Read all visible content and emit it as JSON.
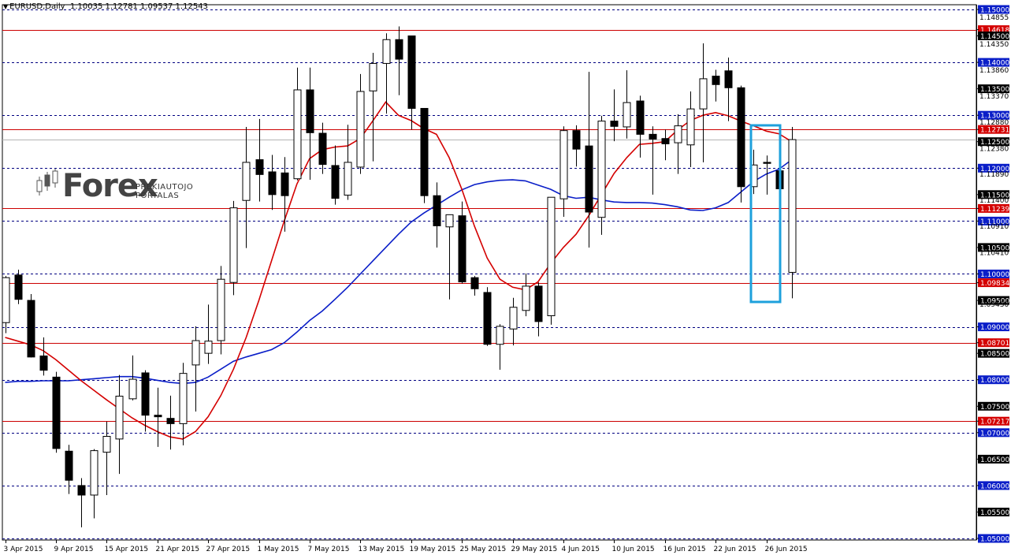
{
  "header": {
    "symbol": "EURUSD,Daily",
    "ohlc": "1.10035 1.12781 1.09537 1.12543"
  },
  "logo": {
    "main": "Forex",
    "line1": "PREKIAUTOJO",
    "line2": "PORTALAS"
  },
  "colors": {
    "bull_body": "#ffffff",
    "bear_body": "#000000",
    "dashed_level": "#000080",
    "red_level": "#cc0000",
    "ma_fast": "#d40000",
    "ma_slow": "#0a1ec8",
    "highlight": "#1ea0dc",
    "label_red": "#d40000",
    "label_blue": "#0a1ec8",
    "label_black": "#000000"
  },
  "chart_data": {
    "type": "candlestick",
    "symbol": "EURUSD",
    "timeframe": "Daily",
    "ylim": [
      1.05,
      1.15
    ],
    "x_tick_labels": [
      "3 Apr 2015",
      "9 Apr 2015",
      "15 Apr 2015",
      "21 Apr 2015",
      "27 Apr 2015",
      "1 May 2015",
      "7 May 2015",
      "13 May 2015",
      "19 May 2015",
      "25 May 2015",
      "29 May 2015",
      "4 Jun 2015",
      "10 Jun 2015",
      "16 Jun 2015",
      "22 Jun 2015",
      "26 Jun 2015"
    ],
    "x_tick_index": [
      0,
      4,
      8,
      12,
      16,
      20,
      24,
      28,
      32,
      36,
      40,
      44,
      48,
      52,
      56,
      60
    ],
    "price_labels": [
      {
        "text": "1.15000",
        "value": 1.15,
        "style": "blue"
      },
      {
        "text": "1.14855",
        "value": 1.14855,
        "style": "plain"
      },
      {
        "text": "1.14618",
        "value": 1.14618,
        "style": "red"
      },
      {
        "text": "1.14500",
        "value": 1.145,
        "style": "black"
      },
      {
        "text": "1.14350",
        "value": 1.1435,
        "style": "plain"
      },
      {
        "text": "1.14000",
        "value": 1.14,
        "style": "blue"
      },
      {
        "text": "1.13860",
        "value": 1.1386,
        "style": "plain"
      },
      {
        "text": "1.13500",
        "value": 1.135,
        "style": "black"
      },
      {
        "text": "1.13370",
        "value": 1.1337,
        "style": "plain"
      },
      {
        "text": "1.13000",
        "value": 1.13,
        "style": "blue"
      },
      {
        "text": "1.12880",
        "value": 1.1288,
        "style": "plain"
      },
      {
        "text": "1.12731",
        "value": 1.12731,
        "style": "red"
      },
      {
        "text": "1.12500",
        "value": 1.125,
        "style": "black"
      },
      {
        "text": "1.12380",
        "value": 1.1238,
        "style": "plain"
      },
      {
        "text": "1.12000",
        "value": 1.12,
        "style": "blue"
      },
      {
        "text": "1.11890",
        "value": 1.1189,
        "style": "plain"
      },
      {
        "text": "1.11500",
        "value": 1.115,
        "style": "black"
      },
      {
        "text": "1.11400",
        "value": 1.114,
        "style": "plain"
      },
      {
        "text": "1.11239",
        "value": 1.11239,
        "style": "red"
      },
      {
        "text": "1.11000",
        "value": 1.11,
        "style": "blue"
      },
      {
        "text": "1.10910",
        "value": 1.1091,
        "style": "plain"
      },
      {
        "text": "1.10500",
        "value": 1.105,
        "style": "black"
      },
      {
        "text": "1.10410",
        "value": 1.1041,
        "style": "plain"
      },
      {
        "text": "1.10000",
        "value": 1.1,
        "style": "blue"
      },
      {
        "text": "1.09834",
        "value": 1.09834,
        "style": "red"
      },
      {
        "text": "1.09500",
        "value": 1.095,
        "style": "black"
      },
      {
        "text": "1.09430",
        "value": 1.0943,
        "style": "plain"
      },
      {
        "text": "1.09000",
        "value": 1.09,
        "style": "blue"
      },
      {
        "text": "1.08701",
        "value": 1.08701,
        "style": "red"
      },
      {
        "text": "1.08500",
        "value": 1.085,
        "style": "black"
      },
      {
        "text": "1.08000",
        "value": 1.08,
        "style": "blue"
      },
      {
        "text": "1.07500",
        "value": 1.075,
        "style": "black"
      },
      {
        "text": "1.07217",
        "value": 1.07217,
        "style": "red"
      },
      {
        "text": "1.07000",
        "value": 1.07,
        "style": "blue"
      },
      {
        "text": "1.06500",
        "value": 1.065,
        "style": "black"
      },
      {
        "text": "1.06000",
        "value": 1.06,
        "style": "blue"
      },
      {
        "text": "1.05500",
        "value": 1.055,
        "style": "black"
      },
      {
        "text": "1.05000",
        "value": 1.05,
        "style": "blue"
      }
    ],
    "dashed_levels": [
      1.15,
      1.14,
      1.13,
      1.12,
      1.11,
      1.1,
      1.09,
      1.08,
      1.07,
      1.06,
      1.05
    ],
    "red_levels": [
      1.14618,
      1.12731,
      1.11239,
      1.09834,
      1.08701,
      1.07217
    ],
    "current_price": 1.12543,
    "candles": [
      {
        "o": 1.0908,
        "h": 1.0996,
        "l": 1.0888,
        "c": 1.0993
      },
      {
        "o": 1.0998,
        "h": 1.1008,
        "l": 1.0943,
        "c": 1.0952
      },
      {
        "o": 1.095,
        "h": 1.0962,
        "l": 1.0842,
        "c": 1.0843
      },
      {
        "o": 1.0845,
        "h": 1.088,
        "l": 1.0808,
        "c": 1.0818
      },
      {
        "o": 1.0805,
        "h": 1.0815,
        "l": 1.0662,
        "c": 1.067
      },
      {
        "o": 1.0665,
        "h": 1.0677,
        "l": 1.0584,
        "c": 1.061
      },
      {
        "o": 1.06,
        "h": 1.0614,
        "l": 1.0521,
        "c": 1.0582
      },
      {
        "o": 1.0582,
        "h": 1.0669,
        "l": 1.0538,
        "c": 1.0666
      },
      {
        "o": 1.0663,
        "h": 1.0721,
        "l": 1.0582,
        "c": 1.0693
      },
      {
        "o": 1.0688,
        "h": 1.0809,
        "l": 1.0622,
        "c": 1.0769
      },
      {
        "o": 1.0764,
        "h": 1.0846,
        "l": 1.0761,
        "c": 1.0801
      },
      {
        "o": 1.0813,
        "h": 1.0818,
        "l": 1.0702,
        "c": 1.0733
      },
      {
        "o": 1.0733,
        "h": 1.0785,
        "l": 1.0673,
        "c": 1.073
      },
      {
        "o": 1.0727,
        "h": 1.077,
        "l": 1.0668,
        "c": 1.0717
      },
      {
        "o": 1.0717,
        "h": 1.0832,
        "l": 1.0676,
        "c": 1.0812
      },
      {
        "o": 1.0828,
        "h": 1.0901,
        "l": 1.074,
        "c": 1.0874
      },
      {
        "o": 1.085,
        "h": 1.0942,
        "l": 1.083,
        "c": 1.0873
      },
      {
        "o": 1.0874,
        "h": 1.1015,
        "l": 1.0848,
        "c": 1.099
      },
      {
        "o": 1.0984,
        "h": 1.1138,
        "l": 1.096,
        "c": 1.1125
      },
      {
        "o": 1.1139,
        "h": 1.1278,
        "l": 1.1049,
        "c": 1.1211
      },
      {
        "o": 1.1216,
        "h": 1.1293,
        "l": 1.1137,
        "c": 1.1188
      },
      {
        "o": 1.1193,
        "h": 1.1225,
        "l": 1.1121,
        "c": 1.115
      },
      {
        "o": 1.1191,
        "h": 1.1221,
        "l": 1.108,
        "c": 1.1148
      },
      {
        "o": 1.118,
        "h": 1.139,
        "l": 1.1177,
        "c": 1.1348
      },
      {
        "o": 1.1348,
        "h": 1.139,
        "l": 1.1178,
        "c": 1.1267
      },
      {
        "o": 1.1266,
        "h": 1.1286,
        "l": 1.1189,
        "c": 1.1207
      },
      {
        "o": 1.1205,
        "h": 1.1243,
        "l": 1.1131,
        "c": 1.1143
      },
      {
        "o": 1.1149,
        "h": 1.1282,
        "l": 1.114,
        "c": 1.1211
      },
      {
        "o": 1.1202,
        "h": 1.1378,
        "l": 1.1189,
        "c": 1.1345
      },
      {
        "o": 1.1346,
        "h": 1.1418,
        "l": 1.1213,
        "c": 1.1398
      },
      {
        "o": 1.1398,
        "h": 1.1455,
        "l": 1.1303,
        "c": 1.1443
      },
      {
        "o": 1.1443,
        "h": 1.1468,
        "l": 1.1338,
        "c": 1.1406
      },
      {
        "o": 1.145,
        "h": 1.145,
        "l": 1.1273,
        "c": 1.1313
      },
      {
        "o": 1.1313,
        "h": 1.1313,
        "l": 1.1134,
        "c": 1.1148
      },
      {
        "o": 1.1148,
        "h": 1.1173,
        "l": 1.105,
        "c": 1.1091
      },
      {
        "o": 1.1089,
        "h": 1.1106,
        "l": 1.0952,
        "c": 1.1112
      },
      {
        "o": 1.111,
        "h": 1.1137,
        "l": 1.0982,
        "c": 1.0985
      },
      {
        "o": 1.0993,
        "h": 1.0996,
        "l": 1.0959,
        "c": 1.0972
      },
      {
        "o": 1.0965,
        "h": 1.0975,
        "l": 1.0864,
        "c": 1.0867
      },
      {
        "o": 1.0867,
        "h": 1.0905,
        "l": 1.0819,
        "c": 1.0901
      },
      {
        "o": 1.0896,
        "h": 1.0955,
        "l": 1.0865,
        "c": 1.0937
      },
      {
        "o": 1.0931,
        "h": 1.1001,
        "l": 1.092,
        "c": 1.0977
      },
      {
        "o": 1.0977,
        "h": 1.0984,
        "l": 1.0882,
        "c": 1.091
      },
      {
        "o": 1.0921,
        "h": 1.114,
        "l": 1.0904,
        "c": 1.1145
      },
      {
        "o": 1.1142,
        "h": 1.1279,
        "l": 1.1108,
        "c": 1.1271
      },
      {
        "o": 1.1271,
        "h": 1.1281,
        "l": 1.1203,
        "c": 1.1236
      },
      {
        "o": 1.1242,
        "h": 1.1382,
        "l": 1.105,
        "c": 1.1117
      },
      {
        "o": 1.1107,
        "h": 1.1299,
        "l": 1.1074,
        "c": 1.1289
      },
      {
        "o": 1.1289,
        "h": 1.1349,
        "l": 1.1251,
        "c": 1.1279
      },
      {
        "o": 1.1278,
        "h": 1.1385,
        "l": 1.1256,
        "c": 1.1324
      },
      {
        "o": 1.1327,
        "h": 1.1337,
        "l": 1.122,
        "c": 1.1264
      },
      {
        "o": 1.1264,
        "h": 1.1279,
        "l": 1.115,
        "c": 1.1255
      },
      {
        "o": 1.1256,
        "h": 1.1273,
        "l": 1.1215,
        "c": 1.1246
      },
      {
        "o": 1.1248,
        "h": 1.1302,
        "l": 1.1189,
        "c": 1.128
      },
      {
        "o": 1.1244,
        "h": 1.1345,
        "l": 1.1202,
        "c": 1.1312
      },
      {
        "o": 1.1312,
        "h": 1.1436,
        "l": 1.1211,
        "c": 1.1369
      },
      {
        "o": 1.1374,
        "h": 1.1386,
        "l": 1.1326,
        "c": 1.1358
      },
      {
        "o": 1.1384,
        "h": 1.1409,
        "l": 1.1289,
        "c": 1.1352
      },
      {
        "o": 1.1352,
        "h": 1.1356,
        "l": 1.1135,
        "c": 1.1165
      },
      {
        "o": 1.1165,
        "h": 1.1235,
        "l": 1.1151,
        "c": 1.1206
      },
      {
        "o": 1.1211,
        "h": 1.1224,
        "l": 1.115,
        "c": 1.1209
      },
      {
        "o": 1.1195,
        "h": 1.1208,
        "l": 1.112,
        "c": 1.1161
      },
      {
        "o": 1.1003,
        "h": 1.1278,
        "l": 1.0954,
        "c": 1.1254
      }
    ],
    "ma_fast": [
      1.088,
      1.0873,
      1.0866,
      1.0855,
      1.0838,
      1.0818,
      1.0798,
      1.078,
      1.0762,
      1.0745,
      1.0728,
      1.0714,
      1.0702,
      1.0692,
      1.0688,
      1.0702,
      1.073,
      1.077,
      1.082,
      1.088,
      1.095,
      1.1025,
      1.11,
      1.117,
      1.1218,
      1.1235,
      1.124,
      1.1242,
      1.1256,
      1.129,
      1.1325,
      1.13,
      1.129,
      1.1275,
      1.1264,
      1.122,
      1.116,
      1.109,
      1.103,
      1.099,
      1.0975,
      1.097,
      1.0985,
      1.102,
      1.105,
      1.1075,
      1.111,
      1.115,
      1.119,
      1.122,
      1.1245,
      1.1247,
      1.125,
      1.1272,
      1.129,
      1.13,
      1.1305,
      1.1299,
      1.1289,
      1.128,
      1.127,
      1.1265,
      1.125
    ],
    "ma_slow": [
      1.0795,
      1.0797,
      1.0797,
      1.0798,
      1.0798,
      1.0798,
      1.08,
      1.0802,
      1.0804,
      1.0806,
      1.0806,
      1.0803,
      1.0799,
      1.0795,
      1.0793,
      1.0795,
      1.0805,
      1.082,
      1.0835,
      1.0843,
      1.085,
      1.0857,
      1.087,
      1.089,
      1.0912,
      1.093,
      1.0952,
      1.0975,
      1.1,
      1.1025,
      1.105,
      1.1075,
      1.1098,
      1.1115,
      1.113,
      1.1145,
      1.1159,
      1.1169,
      1.1174,
      1.1177,
      1.1178,
      1.1176,
      1.1168,
      1.116,
      1.1148,
      1.1143,
      1.1145,
      1.114,
      1.1136,
      1.1135,
      1.1135,
      1.1134,
      1.1131,
      1.1127,
      1.1121,
      1.112,
      1.1125,
      1.1135,
      1.1155,
      1.1175,
      1.1189,
      1.1198,
      1.1216
    ]
  }
}
